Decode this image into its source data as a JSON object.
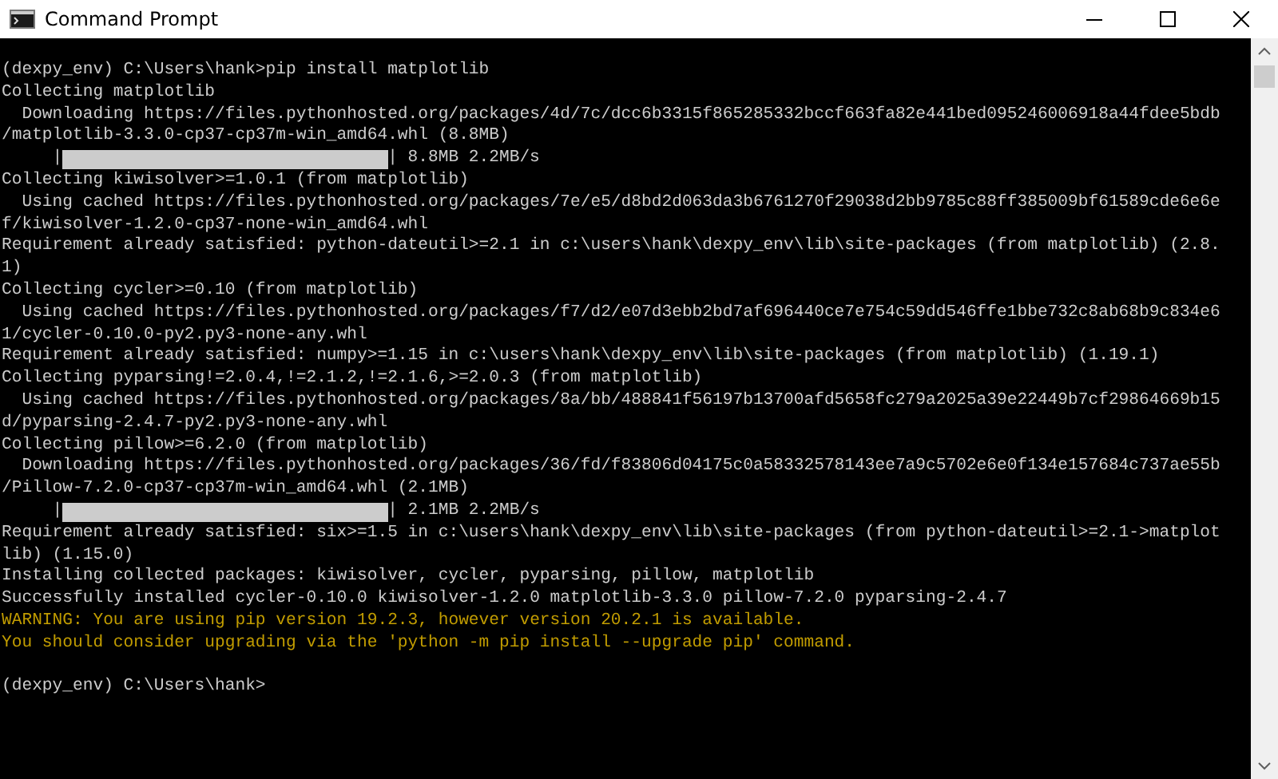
{
  "window": {
    "title": "Command Prompt"
  },
  "console": {
    "lines": [
      {
        "kind": "text",
        "text": "(dexpy_env) C:\\Users\\hank>pip install matplotlib"
      },
      {
        "kind": "text",
        "text": "Collecting matplotlib"
      },
      {
        "kind": "text",
        "text": "  Downloading https://files.pythonhosted.org/packages/4d/7c/dcc6b3315f865285332bccf663fa82e441bed095246006918a44fdee5bdb"
      },
      {
        "kind": "text",
        "text": "/matplotlib-3.3.0-cp37-cp37m-win_amd64.whl (8.8MB)"
      },
      {
        "kind": "progress",
        "left_edge": "|",
        "right_edge": "|",
        "level": 1,
        "reading": "8.8MB 2.2MB/s"
      },
      {
        "kind": "text",
        "text": "Collecting kiwisolver>=1.0.1 (from matplotlib)"
      },
      {
        "kind": "text",
        "text": "  Using cached https://files.pythonhosted.org/packages/7e/e5/d8bd2d063da3b6761270f29038d2bb9785c88ff385009bf61589cde6e6e"
      },
      {
        "kind": "text",
        "text": "f/kiwisolver-1.2.0-cp37-none-win_amd64.whl"
      },
      {
        "kind": "text",
        "text": "Requirement already satisfied: python-dateutil>=2.1 in c:\\users\\hank\\dexpy_env\\lib\\site-packages (from matplotlib) (2.8."
      },
      {
        "kind": "text",
        "text": "1)"
      },
      {
        "kind": "text",
        "text": "Collecting cycler>=0.10 (from matplotlib)"
      },
      {
        "kind": "text",
        "text": "  Using cached https://files.pythonhosted.org/packages/f7/d2/e07d3ebb2bd7af696440ce7e754c59dd546ffe1bbe732c8ab68b9c834e6"
      },
      {
        "kind": "text",
        "text": "1/cycler-0.10.0-py2.py3-none-any.whl"
      },
      {
        "kind": "text",
        "text": "Requirement already satisfied: numpy>=1.15 in c:\\users\\hank\\dexpy_env\\lib\\site-packages (from matplotlib) (1.19.1)"
      },
      {
        "kind": "text",
        "text": "Collecting pyparsing!=2.0.4,!=2.1.2,!=2.1.6,>=2.0.3 (from matplotlib)"
      },
      {
        "kind": "text",
        "text": "  Using cached https://files.pythonhosted.org/packages/8a/bb/488841f56197b13700afd5658fc279a2025a39e22449b7cf29864669b15"
      },
      {
        "kind": "text",
        "text": "d/pyparsing-2.4.7-py2.py3-none-any.whl"
      },
      {
        "kind": "text",
        "text": "Collecting pillow>=6.2.0 (from matplotlib)"
      },
      {
        "kind": "text",
        "text": "  Downloading https://files.pythonhosted.org/packages/36/fd/f83806d04175c0a58332578143ee7a9c5702e6e0f134e157684c737ae55b"
      },
      {
        "kind": "text",
        "text": "/Pillow-7.2.0-cp37-cp37m-win_amd64.whl (2.1MB)"
      },
      {
        "kind": "progress",
        "left_edge": "|",
        "right_edge": "|",
        "level": 1,
        "reading": "2.1MB 2.2MB/s"
      },
      {
        "kind": "text",
        "text": "Requirement already satisfied: six>=1.5 in c:\\users\\hank\\dexpy_env\\lib\\site-packages (from python-dateutil>=2.1->matplot"
      },
      {
        "kind": "text",
        "text": "lib) (1.15.0)"
      },
      {
        "kind": "text",
        "text": "Installing collected packages: kiwisolver, cycler, pyparsing, pillow, matplotlib"
      },
      {
        "kind": "text",
        "text": "Successfully installed cycler-0.10.0 kiwisolver-1.2.0 matplotlib-3.3.0 pillow-7.2.0 pyparsing-2.4.7"
      },
      {
        "kind": "warning",
        "text": "WARNING: You are using pip version 19.2.3, however version 20.2.1 is available."
      },
      {
        "kind": "warning",
        "text": "You should consider upgrading via the 'python -m pip install --upgrade pip' command."
      },
      {
        "kind": "blank"
      },
      {
        "kind": "text",
        "text": "(dexpy_env) C:\\Users\\hank>"
      }
    ]
  }
}
